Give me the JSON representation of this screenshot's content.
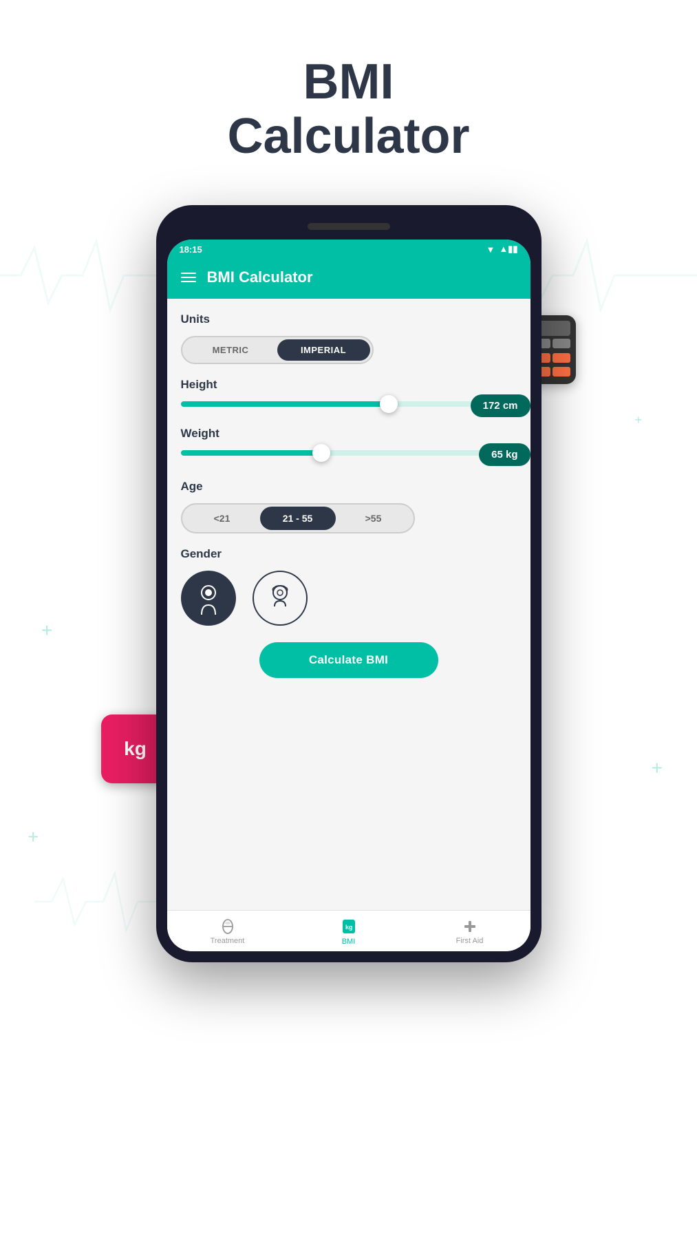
{
  "page": {
    "title_line1": "BMI",
    "title_line2": "Calculator",
    "background_color": "#ffffff"
  },
  "status_bar": {
    "time": "18:15",
    "signal": "▼▲▮▮"
  },
  "header": {
    "title": "BMI Calculator",
    "menu_icon": "≡"
  },
  "units": {
    "label": "Units",
    "options": [
      "METRIC",
      "IMPERIAL"
    ],
    "selected": "IMPERIAL"
  },
  "height": {
    "label": "Height",
    "value": "172 cm",
    "fill_percent": 62
  },
  "weight": {
    "label": "Weight",
    "value": "65 kg",
    "fill_percent": 42
  },
  "age": {
    "label": "Age",
    "options": [
      "<21",
      "21 - 55",
      ">55"
    ],
    "selected": "21 - 55"
  },
  "gender": {
    "label": "Gender",
    "options": [
      "male",
      "female"
    ],
    "selected": "male"
  },
  "calculate_button": {
    "label": "Calculate BMI"
  },
  "bottom_nav": {
    "items": [
      {
        "id": "treatment",
        "label": "Treatment",
        "icon": "💊",
        "active": false
      },
      {
        "id": "bmi",
        "label": "BMI",
        "icon": "🛍",
        "active": true
      },
      {
        "id": "first_aid",
        "label": "First Aid",
        "icon": "➕",
        "active": false
      }
    ]
  },
  "stickers": {
    "calculator": "🖩",
    "kg": "kg"
  }
}
